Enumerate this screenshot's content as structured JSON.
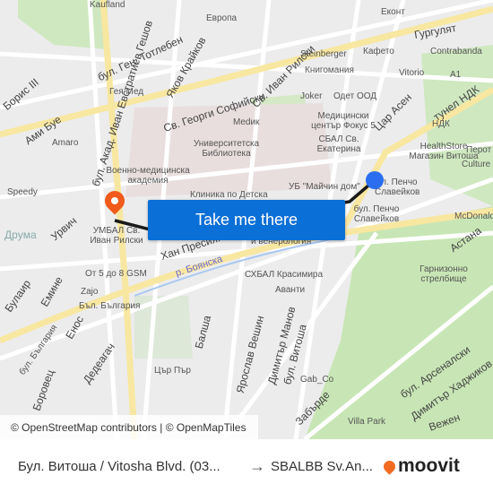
{
  "map": {
    "labels": [
      "бул. Ген. Тотлебен",
      "бул. Акад. Иван Евстратиев Гешов",
      "Яков Крайков",
      "Св. Иван Рилски",
      "Св. Георги Софийски",
      "Гургулят",
      "Цар Асен",
      "тунел НДК",
      "Хан Пресиян",
      "р. Боянска",
      "Астана",
      "бул. България",
      "Емине",
      "Урвич",
      "Ами Буе",
      "бул. Витоша",
      "Димитър Манов",
      "Ярослав Вешин",
      "Балша",
      "Дедеагач",
      "Енос",
      "Боровец",
      "Забърде",
      "бул. Арсеналски",
      "Димитър Хаджиков",
      "Вежен",
      "Булаир",
      "Борис III",
      "Бъл. България",
      "Военно-медицинска академия",
      "Университетска Библиотека",
      "Клиника по Детска",
      "УБ \"Майчин дом\"",
      "СБАЛ Св. Екатерина",
      "Медицински център Фокус 5",
      "бул. Пенчо Славейков",
      "HealthStore Магазин Витоша",
      "НДК",
      "Medик",
      "Joker",
      "Одет ООД",
      "Книгомания",
      "Steinberger",
      "Кафето",
      "Европа",
      "Гея Мед",
      "Amaro",
      "Speedy",
      "От 5 до 8 GSM",
      "Zajo",
      "СХБАЛ Красимира",
      "Аванти",
      "Гарнизонно стрелбище",
      "McDonald's",
      "Culture Be",
      "Перот",
      "Vitorio",
      "Contrabanda",
      "Еконт",
      "A1",
      "Gab_Co",
      "Villa Park",
      "Цър Пър",
      "и венерология",
      "Kaufland",
      "Дрyма",
      "УМБАЛ Св. Иван Рилски",
      "ул. Пенчо Славейков"
    ]
  },
  "origin_color": "#2b6ff0",
  "destination_color": "#f05a1a",
  "route_color": "#1a1a1a",
  "cta": {
    "label": "Take me there",
    "color": "#0a6fd6"
  },
  "attribution": "© OpenStreetMap contributors | © OpenMapTiles",
  "footer": {
    "from": "Бул. Витоша / Vitosha Blvd. (03...",
    "arrow": "→",
    "to": "SBALBB Sv.An...",
    "logo": "moovit",
    "logo_color": "#f26b21"
  }
}
